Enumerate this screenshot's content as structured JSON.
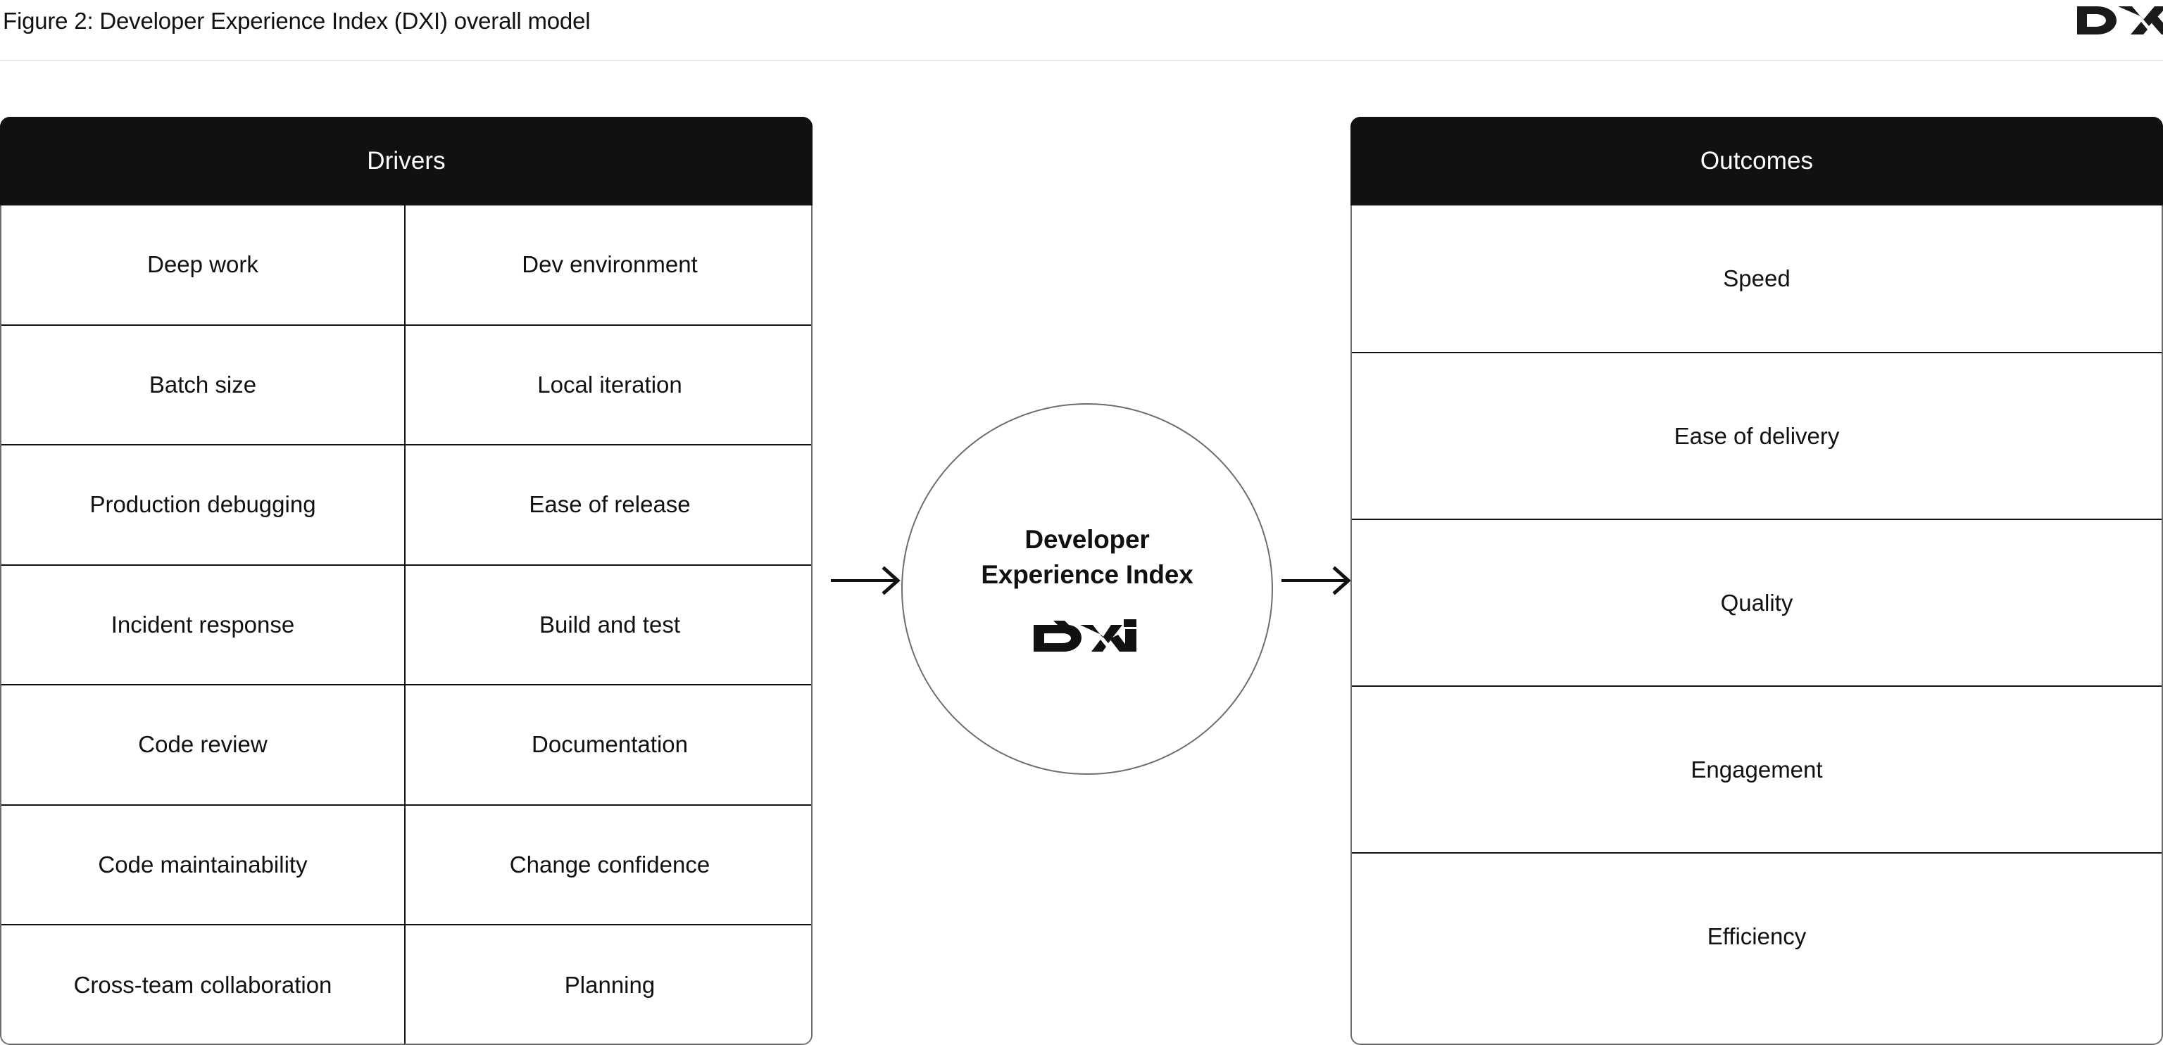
{
  "figure": {
    "title": "Figure 2: Developer Experience Index (DXI) overall model",
    "brand_logo_name": "dx-logo",
    "accent_color": "#111111",
    "panel_border_color": "#6d6d6d",
    "rule_color": "#e8e8e8",
    "background_color": "#ffffff"
  },
  "drivers": {
    "header": "Drivers",
    "columns": [
      {
        "name": "left",
        "items": [
          "Deep work",
          "Batch size",
          "Production debugging",
          "Incident response",
          "Code review",
          "Code maintainability",
          "Cross-team collaboration"
        ]
      },
      {
        "name": "right",
        "items": [
          "Dev environment",
          "Local iteration",
          "Ease of release",
          "Build and test",
          "Documentation",
          "Change confidence",
          "Planning"
        ]
      }
    ]
  },
  "center": {
    "title_line_1": "Developer",
    "title_line_2": "Experience Index",
    "logo_name": "dxi-logo",
    "logo_text": "DXI"
  },
  "outcomes": {
    "header": "Outcomes",
    "items": [
      "Speed",
      "Ease of delivery",
      "Quality",
      "Engagement",
      "Efficiency"
    ]
  },
  "arrows": [
    {
      "name": "drivers-to-index",
      "direction": "right"
    },
    {
      "name": "index-to-outcomes",
      "direction": "right"
    }
  ],
  "chart_data": {
    "type": "diagram",
    "title": "Figure 2: Developer Experience Index (DXI) overall model",
    "structure": "drivers -> index -> outcomes",
    "nodes": {
      "drivers": [
        "Deep work",
        "Dev environment",
        "Batch size",
        "Local iteration",
        "Production debugging",
        "Ease of release",
        "Incident response",
        "Build and test",
        "Code review",
        "Documentation",
        "Code maintainability",
        "Change confidence",
        "Cross-team collaboration",
        "Planning"
      ],
      "index": "Developer Experience Index",
      "outcomes": [
        "Speed",
        "Ease of delivery",
        "Quality",
        "Engagement",
        "Efficiency"
      ]
    },
    "edges": [
      {
        "from": "Drivers",
        "to": "Developer Experience Index"
      },
      {
        "from": "Developer Experience Index",
        "to": "Outcomes"
      }
    ]
  }
}
